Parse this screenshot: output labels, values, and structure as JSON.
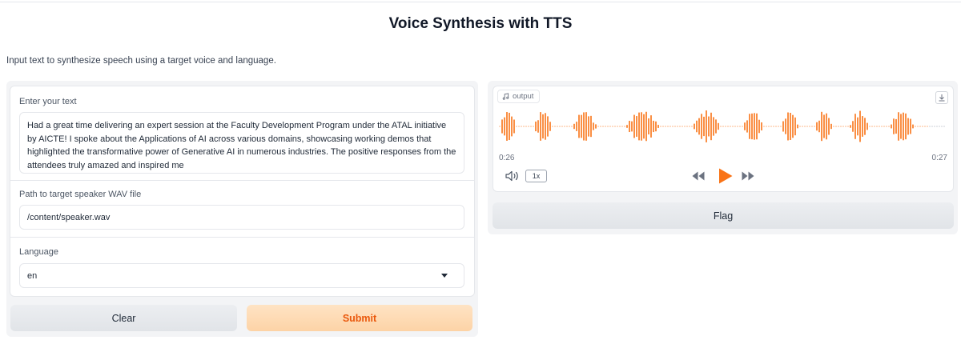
{
  "app": {
    "title": "Voice Synthesis with TTS",
    "description": "Input text to synthesize speech using a target voice and language."
  },
  "form": {
    "text": {
      "label": "Enter your text",
      "value": "Had a great time delivering an expert session at the Faculty Development Program under the ATAL initiative by AICTE! I spoke about the Applications of AI across various domains, showcasing working demos that highlighted the transformative power of Generative AI in numerous industries. The positive responses from the attendees truly amazed and inspired me"
    },
    "speaker": {
      "label": "Path to target speaker WAV file",
      "value": "/content/speaker.wav"
    },
    "language": {
      "label": "Language",
      "value": "en"
    }
  },
  "buttons": {
    "clear": "Clear",
    "submit": "Submit",
    "flag": "Flag"
  },
  "audio": {
    "label": "output",
    "current_time": "0:26",
    "total_time": "0:27",
    "playback_rate": "1x",
    "progress": 0.957,
    "played_color": "#f97316",
    "unplayed_color": "#9ca3af"
  }
}
